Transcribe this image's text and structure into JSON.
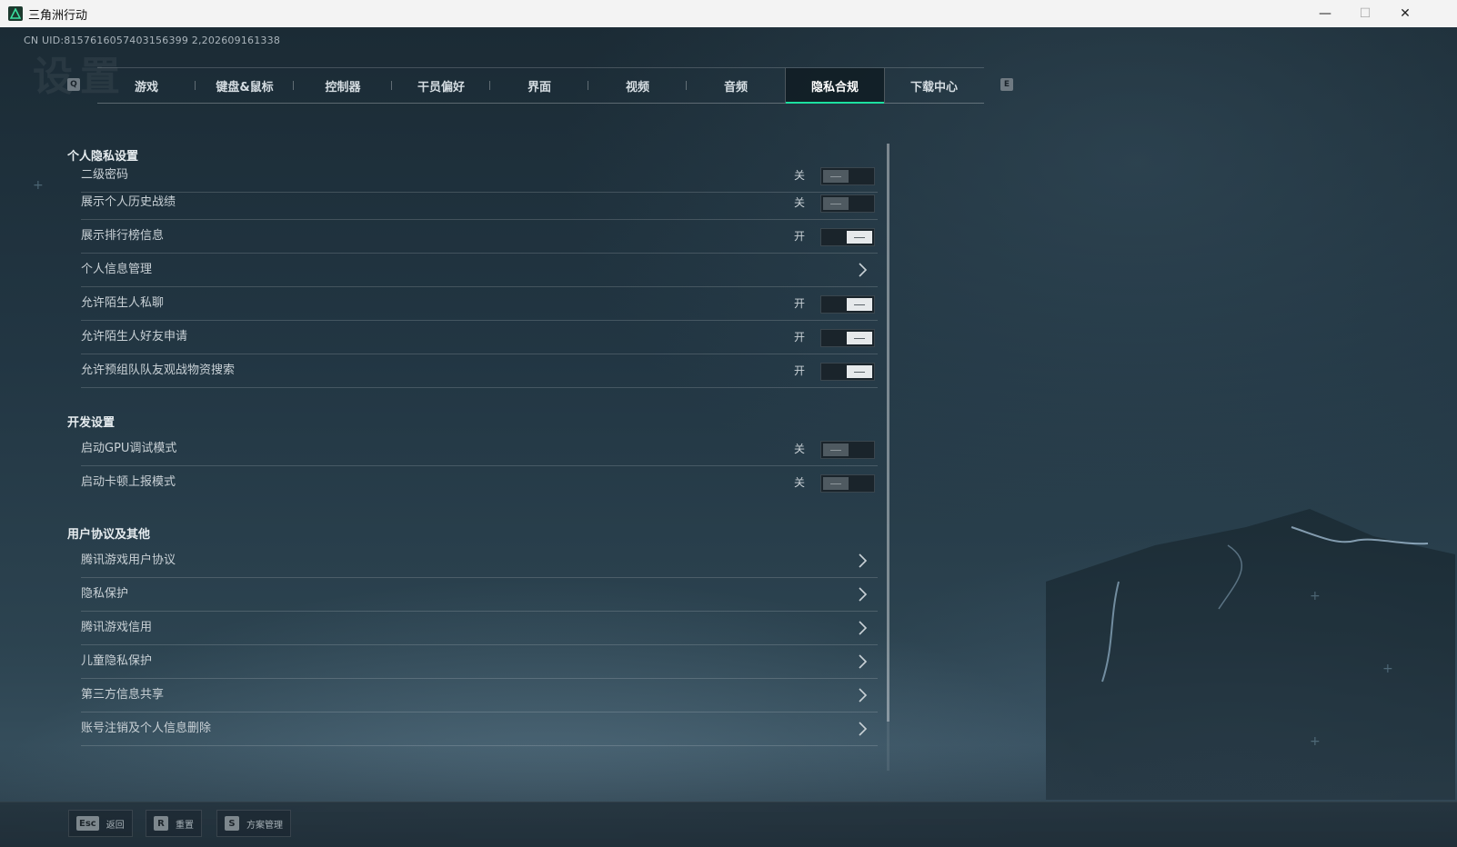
{
  "window": {
    "title": "三角洲行动",
    "minimize": "—",
    "maximize": "☐",
    "close": "✕"
  },
  "uid": "CN UID:8157616057403156399 2,202609161338",
  "page_bg_title": "设置",
  "tabs": {
    "left_key": "Q",
    "right_key": "E",
    "items": [
      {
        "label": "游戏"
      },
      {
        "label": "键盘&鼠标"
      },
      {
        "label": "控制器"
      },
      {
        "label": "干员偏好"
      },
      {
        "label": "界面"
      },
      {
        "label": "视频"
      },
      {
        "label": "音频"
      },
      {
        "label": "隐私合规",
        "active": true
      },
      {
        "label": "下载中心"
      }
    ]
  },
  "sections": {
    "privacy": {
      "title": "个人隐私设置",
      "rows": [
        {
          "label": "二级密码",
          "state": "关",
          "on": false
        },
        {
          "label": "展示个人历史战绩",
          "state": "关",
          "on": false
        },
        {
          "label": "展示排行榜信息",
          "state": "开",
          "on": true
        },
        {
          "label": "个人信息管理",
          "link": true
        },
        {
          "label": "允许陌生人私聊",
          "state": "开",
          "on": true
        },
        {
          "label": "允许陌生人好友申请",
          "state": "开",
          "on": true
        },
        {
          "label": "允许预组队队友观战物资搜索",
          "state": "开",
          "on": true
        }
      ]
    },
    "dev": {
      "title": "开发设置",
      "rows": [
        {
          "label": "启动GPU调试模式",
          "state": "关",
          "on": false
        },
        {
          "label": "启动卡顿上报模式",
          "state": "关",
          "on": false
        }
      ]
    },
    "agreements": {
      "title": "用户协议及其他",
      "rows": [
        {
          "label": "腾讯游戏用户协议",
          "link": true
        },
        {
          "label": "隐私保护",
          "link": true
        },
        {
          "label": "腾讯游戏信用",
          "link": true
        },
        {
          "label": "儿童隐私保护",
          "link": true
        },
        {
          "label": "第三方信息共享",
          "link": true
        },
        {
          "label": "账号注销及个人信息删除",
          "link": true
        }
      ]
    }
  },
  "bottom": {
    "back": {
      "key": "Esc",
      "label": "返回"
    },
    "reset": {
      "key": "R",
      "label": "重置"
    },
    "plans": {
      "key": "S",
      "label": "方案管理"
    }
  },
  "colors": {
    "accent": "#1de0a0",
    "toggle_on": "#e6e9eb",
    "toggle_off": "#4f5a61"
  }
}
